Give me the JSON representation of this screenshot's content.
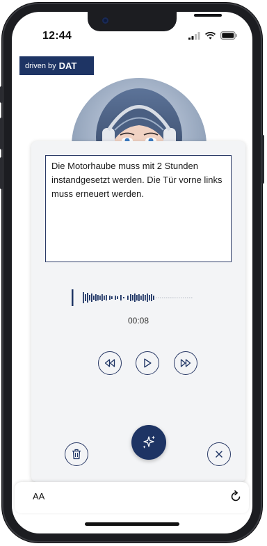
{
  "status_bar": {
    "time": "12:44"
  },
  "header": {
    "badge_prefix": "driven by",
    "badge_brand": "DAT"
  },
  "dictation": {
    "text": " Die Motorhaube muss mit 2 Stunden instandgesetzt werden. Die Tür vorne links muss erneuert werden.",
    "elapsed_time": "00:08"
  },
  "playback_controls": {
    "rewind_icon": "rewind-icon",
    "play_icon": "play-icon",
    "fast_forward_icon": "fast-forward-icon"
  },
  "actions": {
    "delete_icon": "trash-icon",
    "magic_icon": "sparkles-icon",
    "close_icon": "close-icon"
  },
  "browser_bar": {
    "text_size_label": "AA",
    "reload_icon": "reload-icon"
  },
  "colors": {
    "accent": "#1e3464",
    "card_bg": "#f3f4f6",
    "frame": "#1c1d21"
  }
}
